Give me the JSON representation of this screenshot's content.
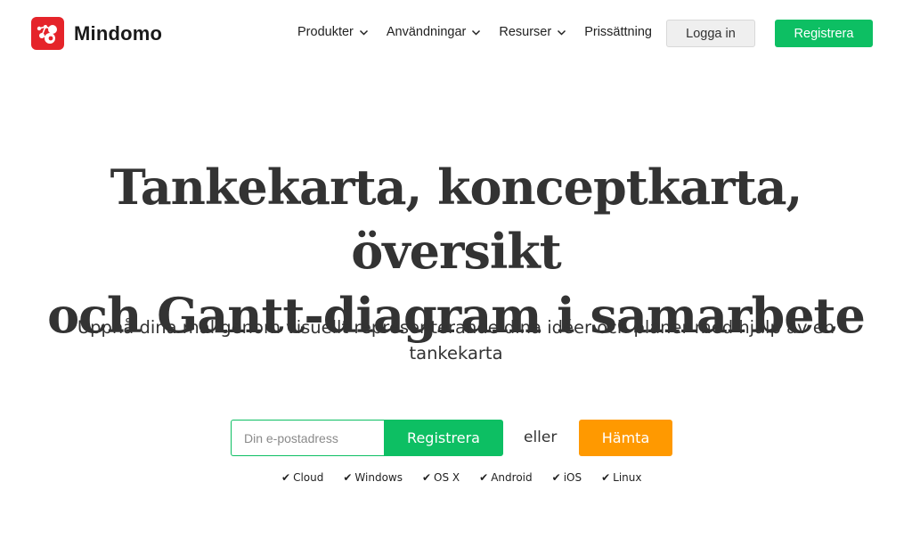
{
  "brand": {
    "name": "Mindomo",
    "color": "#e5242a"
  },
  "nav": {
    "items": [
      {
        "label": "Produkter",
        "has_dropdown": true
      },
      {
        "label": "Användningar",
        "has_dropdown": true
      },
      {
        "label": "Resurser",
        "has_dropdown": true
      },
      {
        "label": "Prissättning",
        "has_dropdown": false
      }
    ],
    "login_label": "Logga in",
    "register_label": "Registrera"
  },
  "hero": {
    "title_line1": "Tankekarta, konceptkarta, översikt",
    "title_line2": "och Gantt-diagram i samarbete",
    "subtitle": "Uppnå dina mål genom visuellt representerande dina idéer och planer med hjälp av en tankekarta"
  },
  "signup": {
    "email_placeholder": "Din e-postadress",
    "email_value": "",
    "register_label": "Registrera",
    "or_label": "eller",
    "download_label": "Hämta"
  },
  "platforms": {
    "check_glyph": "✔",
    "items": [
      "Cloud",
      "Windows",
      "OS X",
      "Android",
      "iOS",
      "Linux"
    ]
  },
  "colors": {
    "primary_green": "#0dbf63",
    "download_orange": "#ff9900",
    "login_bg": "#efefef"
  }
}
